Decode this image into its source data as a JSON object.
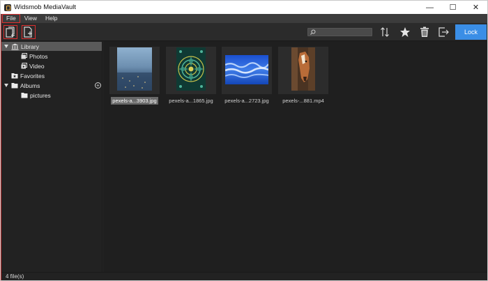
{
  "window": {
    "title": "Widsmob MediaVault",
    "controls": {
      "minimize": "—",
      "maximize": "☐",
      "close": "✕"
    }
  },
  "menu": {
    "items": [
      {
        "label": "File",
        "highlighted": true
      },
      {
        "label": "View",
        "highlighted": false
      },
      {
        "label": "Help",
        "highlighted": false
      }
    ]
  },
  "toolbar": {
    "left_buttons": [
      {
        "icon": "add-files-icon",
        "highlighted": true
      },
      {
        "icon": "add-folder-icon",
        "highlighted": true
      }
    ],
    "search": {
      "value": "",
      "placeholder": ""
    },
    "right_buttons": [
      {
        "icon": "sort-icon"
      },
      {
        "icon": "star-icon"
      },
      {
        "icon": "trash-icon"
      },
      {
        "icon": "export-icon"
      }
    ],
    "lock_label": "Lock"
  },
  "sidebar": {
    "library": {
      "label": "Library",
      "expanded": true,
      "selected": true
    },
    "library_children": [
      {
        "label": "Photos",
        "icon": "photos-icon"
      },
      {
        "label": "Video",
        "icon": "video-icon"
      }
    ],
    "favorites": {
      "label": "Favorites"
    },
    "albums": {
      "label": "Albums",
      "expanded": true
    },
    "album_children": [
      {
        "label": "pictures",
        "icon": "folder-icon"
      }
    ]
  },
  "files": [
    {
      "name": "pexels-a...3903.jpg",
      "selected": true,
      "thumb": "city-dusk"
    },
    {
      "name": "pexels-a...1865.jpg",
      "selected": false,
      "thumb": "green-mandala"
    },
    {
      "name": "pexels-a...2723.jpg",
      "selected": false,
      "thumb": "blue-water"
    },
    {
      "name": "pexels-...881.mp4",
      "selected": false,
      "thumb": "horse"
    }
  ],
  "status": {
    "text": "4 file(s)"
  },
  "colors": {
    "accent": "#3a8ee6",
    "highlight_outline": "#e03030",
    "background": "#1f1f1f"
  }
}
